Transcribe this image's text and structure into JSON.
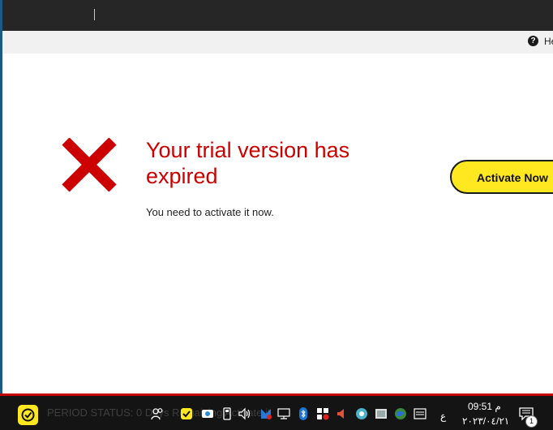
{
  "header": {
    "help_label": "He"
  },
  "main": {
    "title": "Your trial version has expired",
    "subtitle": "You need to activate it now.",
    "activate_label": "Activate Now"
  },
  "colors": {
    "accent_red": "#cc0000",
    "brand_yellow": "#ffe81f"
  },
  "taskbar": {
    "status_text": "PERIOD STATUS:  0 Days Remaining  Activate it",
    "language": "ع",
    "time": "م 09:51",
    "date": "٢٠٢٣/٠٤/٢١",
    "notification_count": "1",
    "tray_icons": [
      "people-icon",
      "norton-tray-icon",
      "onedrive-sync-icon",
      "usb-drive-icon",
      "volume-icon",
      "defender-alert-icon",
      "network-icon",
      "bluetooth-icon",
      "security-center-icon",
      "speaker-muted-icon",
      "app-tray-icon",
      "image-viewer-icon",
      "earth-icon",
      "keyboard-icon"
    ]
  }
}
